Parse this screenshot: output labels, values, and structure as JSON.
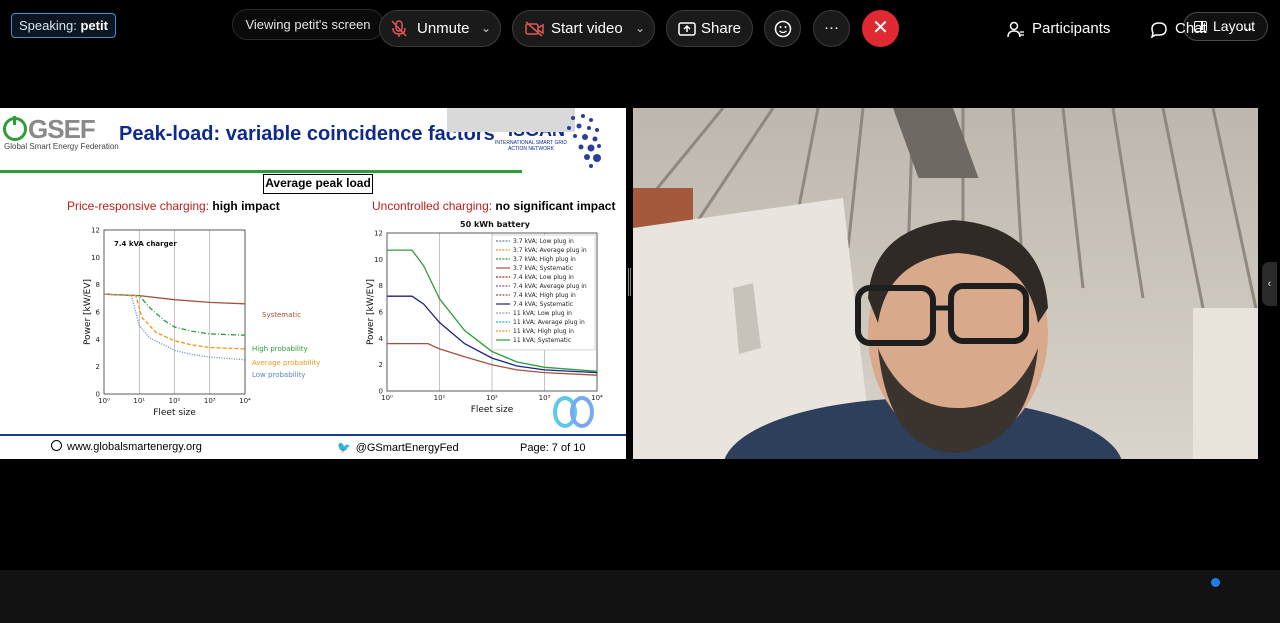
{
  "top_bar": {
    "speaking_prefix": "Speaking:",
    "speaking_name": "petit",
    "viewing": "Viewing petit's screen",
    "layout": "Layout"
  },
  "slide": {
    "logo": "GSEF",
    "logo_sub": "Global Smart Energy Federation",
    "title": "Peak-load: variable coincidence factors",
    "isgan": "ISGAN",
    "isgan_sub": "INTERNATIONAL SMART GRID ACTION NETWORK",
    "box_label": "Average peak load",
    "left_header_colored": "Price-responsive charging:",
    "left_header_bold": "high impact",
    "right_header_colored": "Uncontrolled charging:",
    "right_header_bold": "no significant impact",
    "footer_web": "www.globalsmartenergy.org",
    "footer_twitter": "@GSmartEnergyFed",
    "footer_page": "Page: 7 of 10"
  },
  "chart_data": [
    {
      "type": "line",
      "title": "7.4 kVA charger",
      "xlabel": "Fleet size",
      "ylabel": "Power [kW/EV]",
      "xscale": "log",
      "xlim": [
        1,
        10000
      ],
      "ylim": [
        0,
        12
      ],
      "x_ticks": [
        "10⁰",
        "10¹",
        "10²",
        "10³",
        "10⁴"
      ],
      "y_ticks": [
        "0",
        "2",
        "4",
        "6",
        "8",
        "10",
        "12"
      ],
      "grid": true,
      "annotations": [
        "Systematic",
        "High probability",
        "Average probability",
        "Low probability"
      ],
      "series": [
        {
          "name": "Systematic",
          "color": "#a0523d",
          "dash": "solid",
          "x": [
            1,
            10,
            100,
            1000,
            10000
          ],
          "y": [
            7.3,
            7.2,
            6.9,
            6.7,
            6.6
          ]
        },
        {
          "name": "High probability",
          "color": "#2e9c3a",
          "dash": "dashdot",
          "x": [
            1,
            10,
            20,
            50,
            100,
            300,
            1000,
            10000
          ],
          "y": [
            7.3,
            7.2,
            6.3,
            5.4,
            4.9,
            4.6,
            4.4,
            4.3
          ]
        },
        {
          "name": "Average probability",
          "color": "#f2941d",
          "dash": "dashed",
          "x": [
            1,
            8,
            12,
            30,
            100,
            300,
            1000,
            10000
          ],
          "y": [
            7.3,
            7.2,
            5.6,
            4.5,
            3.9,
            3.6,
            3.4,
            3.3
          ]
        },
        {
          "name": "Low probability",
          "color": "#5b85c4",
          "dash": "dotted",
          "x": [
            1,
            6,
            10,
            20,
            100,
            300,
            1000,
            10000
          ],
          "y": [
            7.3,
            7.2,
            5.0,
            4.1,
            3.2,
            2.9,
            2.7,
            2.5
          ]
        }
      ]
    },
    {
      "type": "line",
      "title": "50 kWh battery",
      "xlabel": "Fleet size",
      "ylabel": "Power [kW/EV]",
      "xscale": "log",
      "xlim": [
        1,
        10000
      ],
      "ylim": [
        0,
        12
      ],
      "x_ticks": [
        "10⁰",
        "10¹",
        "10²",
        "10³",
        "10⁴"
      ],
      "y_ticks": [
        "0",
        "2",
        "4",
        "6",
        "8",
        "10",
        "12"
      ],
      "grid": true,
      "legend_position": "top-right",
      "legend": [
        "3.7 kVA; Low plug in",
        "3.7 kVA; Average plug in",
        "3.7 kVA; High plug in",
        "3.7 kVA; Systematic",
        "7.4 kVA; Low plug in",
        "7.4 kVA; Average plug in",
        "7.4 kVA; High plug in",
        "7.4 kVA; Systematic",
        "11 kVA; Low plug in",
        "11 kVA; Average plug in",
        "11 kVA; High plug in",
        "11 kVA; Systematic"
      ],
      "legend_colors": [
        "#5b85c4",
        "#f2941d",
        "#2e9c3a",
        "#a0523d",
        "#c0201a",
        "#7a5bb0",
        "#8c564b",
        "#1f1f8c",
        "#999999",
        "#17b3c9",
        "#f2941d",
        "#2e9c3a"
      ],
      "series": [
        {
          "name": "11 kVA; Systematic",
          "color": "#2e9c3a",
          "x": [
            1,
            3,
            5,
            10,
            30,
            100,
            300,
            1000,
            10000
          ],
          "y": [
            10.7,
            10.7,
            9.5,
            7.0,
            4.6,
            3.0,
            2.2,
            1.8,
            1.5
          ]
        },
        {
          "name": "7.4 kVA; Systematic",
          "color": "#1f1f8c",
          "x": [
            1,
            3,
            5,
            10,
            30,
            100,
            300,
            1000,
            10000
          ],
          "y": [
            7.2,
            7.2,
            6.6,
            5.2,
            3.6,
            2.5,
            1.9,
            1.6,
            1.4
          ]
        },
        {
          "name": "3.7 kVA; Systematic",
          "color": "#a0523d",
          "x": [
            1,
            3,
            6,
            10,
            30,
            100,
            300,
            1000,
            10000
          ],
          "y": [
            3.6,
            3.6,
            3.6,
            3.2,
            2.6,
            2.0,
            1.6,
            1.4,
            1.2
          ]
        }
      ]
    }
  ],
  "toolbar": {
    "unmute": "Unmute",
    "start_video": "Start video",
    "share": "Share",
    "more": "···",
    "participants": "Participants",
    "chat": "Chat",
    "overflow": "···"
  }
}
